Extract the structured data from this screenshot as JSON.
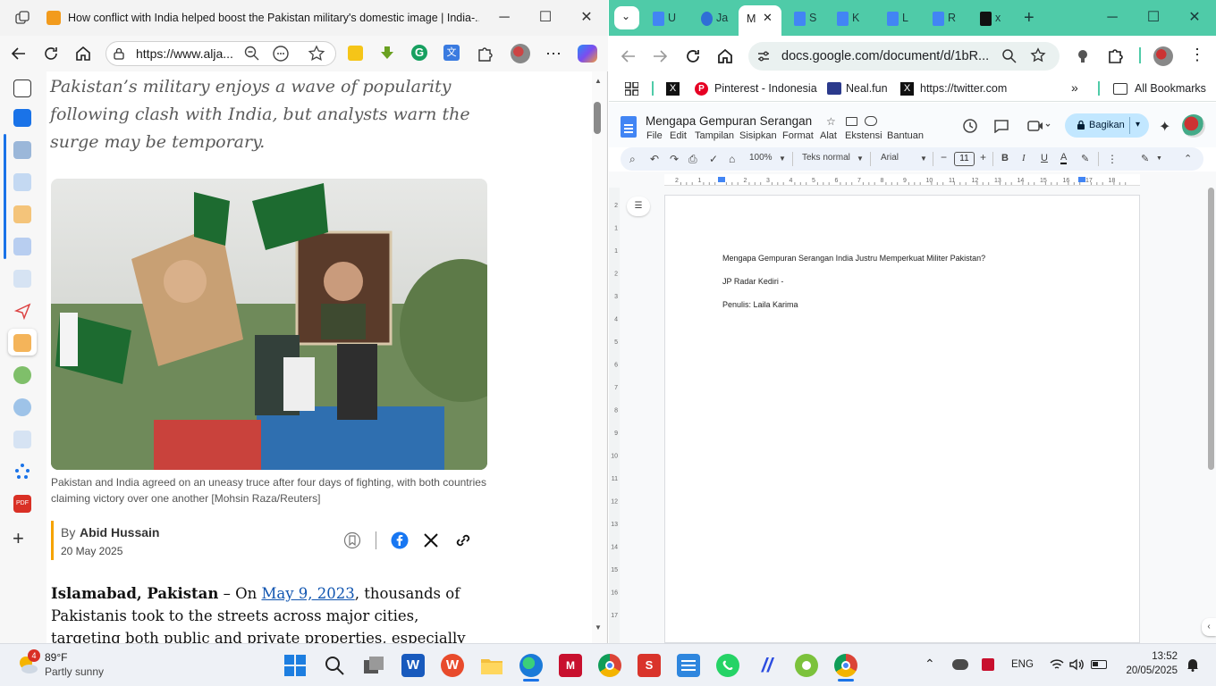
{
  "edge": {
    "tab_title": "How conflict with India helped boost the Pakistan military's domestic image | India-...",
    "url": "https://www.alja...",
    "article": {
      "dek": "Pakistan’s military enjoys a wave of popularity following clash with India, but analysts warn the surge may be temporary.",
      "caption": "Pakistan and India agreed on an uneasy truce after four days of fighting, with both countries claiming victory over one another [Mohsin Raza/Reuters]",
      "byline_prefix": "By",
      "author": "Abid Hussain",
      "date": "20 May 2025",
      "body_location": "Islamabad, Pakistan",
      "body_dash": " – On ",
      "body_link": "May 9, 2023",
      "body_rest": ", thousands of Pakistanis took to the streets across major cities, targeting both public and private properties, especially those affiliated with the"
    }
  },
  "chrome": {
    "tabs": [
      {
        "label": "U",
        "icon": "docs-icon"
      },
      {
        "label": "Ja",
        "icon": "globe-icon"
      },
      {
        "label": "M",
        "icon": "none",
        "active": true
      },
      {
        "label": "S",
        "icon": "docs-icon"
      },
      {
        "label": "K",
        "icon": "docs-icon"
      },
      {
        "label": "L",
        "icon": "docs-icon"
      },
      {
        "label": "R",
        "icon": "docs-icon"
      },
      {
        "label": "x",
        "icon": "x-icon"
      }
    ],
    "url": "docs.google.com/document/d/1bR...",
    "bookmarks": {
      "pinterest": "Pinterest - Indonesia",
      "nealfun": "Neal.fun",
      "twitter": "https://twitter.com",
      "all": "All Bookmarks"
    }
  },
  "docs": {
    "title": "Mengapa Gempuran Serangan In...",
    "menu": [
      "File",
      "Edit",
      "Tampilan",
      "Sisipkan",
      "Format",
      "Alat",
      "Ekstensi",
      "Bantuan"
    ],
    "share_label": "Bagikan",
    "zoom": "100%",
    "style": "Teks normal",
    "font": "Arial",
    "font_size": "11",
    "ruler_numbers": [
      "2",
      "1",
      "1",
      "2",
      "3",
      "4",
      "5",
      "6",
      "7",
      "8",
      "9",
      "10",
      "11",
      "12",
      "13",
      "14",
      "15",
      "16",
      "17",
      "18"
    ],
    "vruler_numbers": [
      "2",
      "1",
      "1",
      "2",
      "3",
      "4",
      "5",
      "6",
      "7",
      "8",
      "9",
      "10",
      "11",
      "12",
      "13",
      "14",
      "15",
      "16",
      "17"
    ],
    "lines": [
      "Mengapa Gempuran Serangan India Justru Memperkuat Militer Pakistan?",
      "JP Radar Kediri -",
      "Penulis: Laila Karima"
    ]
  },
  "taskbar": {
    "weather_badge": "4",
    "weather_temp": "89°F",
    "weather_desc": "Partly sunny",
    "lang": "ENG",
    "time": "13:52",
    "date": "20/05/2025"
  },
  "colors": {
    "chrome_accent": "#4fcba8",
    "docs_share": "#c2e7ff",
    "aj_orange": "#f5a300"
  }
}
